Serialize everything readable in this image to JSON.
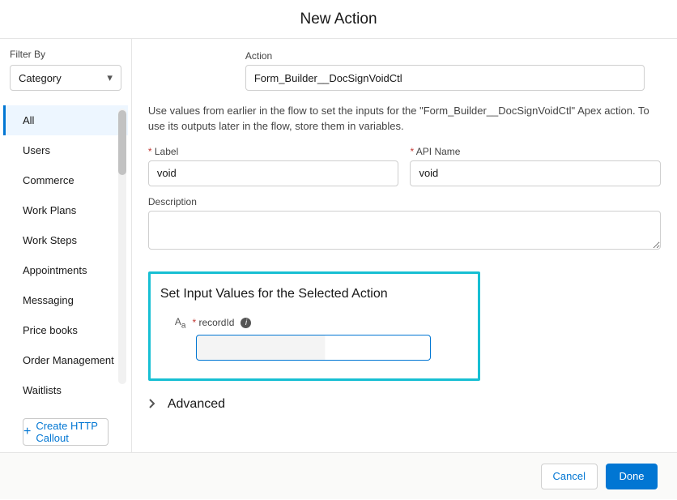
{
  "header": {
    "title": "New Action"
  },
  "sidebar": {
    "filter_label": "Filter By",
    "filter_value": "Category",
    "categories": {
      "c0": "All",
      "c1": "Users",
      "c2": "Commerce",
      "c3": "Work Plans",
      "c4": "Work Steps",
      "c5": "Appointments",
      "c6": "Messaging",
      "c7": "Price books",
      "c8": "Order Management",
      "c9": "Waitlists"
    },
    "callout_label": "Create HTTP Callout"
  },
  "main": {
    "action_label": "Action",
    "action_value": "Form_Builder__DocSignVoidCtl",
    "help_text": "Use values from earlier in the flow to set the inputs for the \"Form_Builder__DocSignVoidCtl\" Apex action. To use its outputs later in the flow, store them in variables.",
    "label_label": "Label",
    "label_value": "void",
    "api_label": "API Name",
    "api_value": "void",
    "description_label": "Description",
    "description_value": "",
    "input_section_title": "Set Input Values for the Selected Action",
    "recordid_label": "recordId",
    "recordid_value": "",
    "advanced_label": "Advanced"
  },
  "footer": {
    "cancel": "Cancel",
    "done": "Done"
  }
}
